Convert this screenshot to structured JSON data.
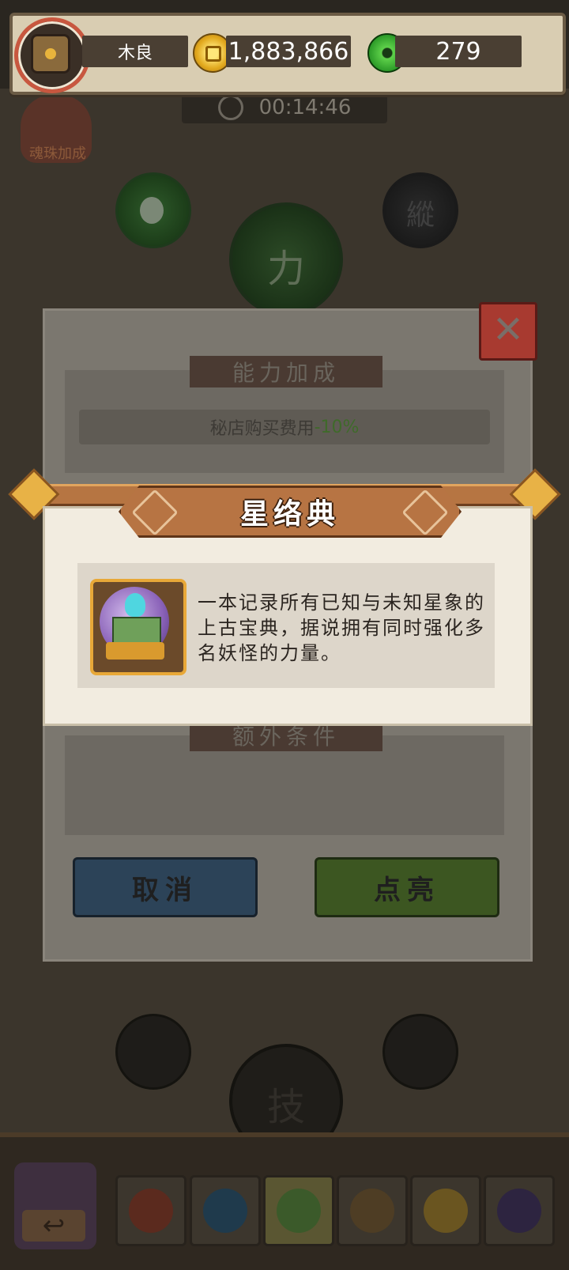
{
  "top_bar": {
    "player_name": "木良",
    "gold": "1,883,866",
    "jade": "279"
  },
  "timer": "00:14:46",
  "background": {
    "bag_label": "魂珠加成",
    "center_orb_label": "力",
    "right_orb_label": "縱",
    "bottom_orb_label": "技"
  },
  "back_panel": {
    "bonus_header": "能力加成",
    "bonus_text": "秘店购买费用",
    "bonus_value": "-10%",
    "condition_header": "额外条件",
    "cancel_label": "取消",
    "light_label": "点亮",
    "close_symbol": "✕"
  },
  "popup": {
    "title": "星络典",
    "description": "一本记录所有已知与未知星象的上古宝典，据说拥有同时强化多名妖怪的力量。"
  },
  "bottom_bar": {
    "back_symbol": "↩",
    "elements": [
      "fire-icon",
      "water-icon",
      "wood-icon",
      "earth-icon",
      "light-icon",
      "dark-icon"
    ]
  }
}
